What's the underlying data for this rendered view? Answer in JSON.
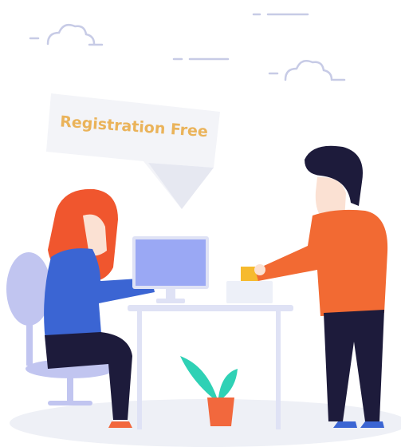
{
  "banner": {
    "text": "Registration Free"
  },
  "colors": {
    "banner_text": "#eab35a",
    "banner_fill": "#f3f4f8",
    "woman_hair": "#f0562e",
    "woman_shirt": "#3b65d3",
    "man_shirt": "#f26a33",
    "pants_dark": "#1d1b3b",
    "monitor": "#9aa8f4",
    "chair": "#c1c5f0",
    "plant_leaves": "#2fd1b5",
    "pot": "#f2683d",
    "card": "#f6ba2e",
    "ground": "#eef0f6",
    "skin": "#fbe1d3"
  },
  "icons": [
    "cloud-icon",
    "speech-banner-icon",
    "computer-monitor-icon",
    "potted-plant-icon",
    "office-chair-icon"
  ]
}
